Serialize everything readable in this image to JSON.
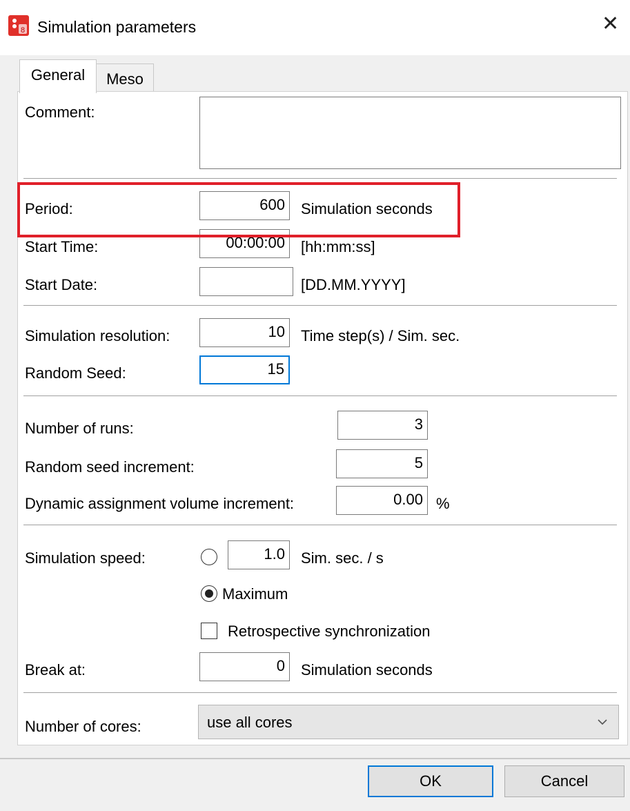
{
  "window": {
    "title": "Simulation parameters",
    "close_glyph": "✕",
    "icon": "vissim-app-icon"
  },
  "tabs": [
    {
      "label": "General",
      "active": true
    },
    {
      "label": "Meso",
      "active": false
    }
  ],
  "general": {
    "comment": {
      "label": "Comment:",
      "value": ""
    },
    "period": {
      "label": "Period:",
      "value": "600",
      "unit": "Simulation seconds"
    },
    "start_time": {
      "label": "Start Time:",
      "value": "00:00:00",
      "unit": "[hh:mm:ss]"
    },
    "start_date": {
      "label": "Start Date:",
      "value": "",
      "unit": "[DD.MM.YYYY]"
    },
    "resolution": {
      "label": "Simulation resolution:",
      "value": "10",
      "unit": "Time step(s) / Sim. sec."
    },
    "random_seed": {
      "label": "Random Seed:",
      "value": "15"
    },
    "number_of_runs": {
      "label": "Number of runs:",
      "value": "3"
    },
    "random_seed_increment": {
      "label": "Random seed increment:",
      "value": "5"
    },
    "dyn_assign_increment": {
      "label": "Dynamic assignment volume increment:",
      "value": "0.00",
      "unit": "%"
    },
    "simulation_speed": {
      "label": "Simulation speed:",
      "custom_value": "1.0",
      "custom_unit": "Sim. sec. / s",
      "maximum_label": "Maximum",
      "selected": "maximum"
    },
    "retrospective_sync": {
      "label": "Retrospective synchronization",
      "checked": false
    },
    "break_at": {
      "label": "Break at:",
      "value": "0",
      "unit": "Simulation seconds"
    },
    "number_of_cores": {
      "label": "Number of cores:",
      "value": "use all cores"
    }
  },
  "buttons": {
    "ok": "OK",
    "cancel": "Cancel"
  },
  "colors": {
    "highlight": "#e0202a",
    "focus": "#0078d7"
  }
}
